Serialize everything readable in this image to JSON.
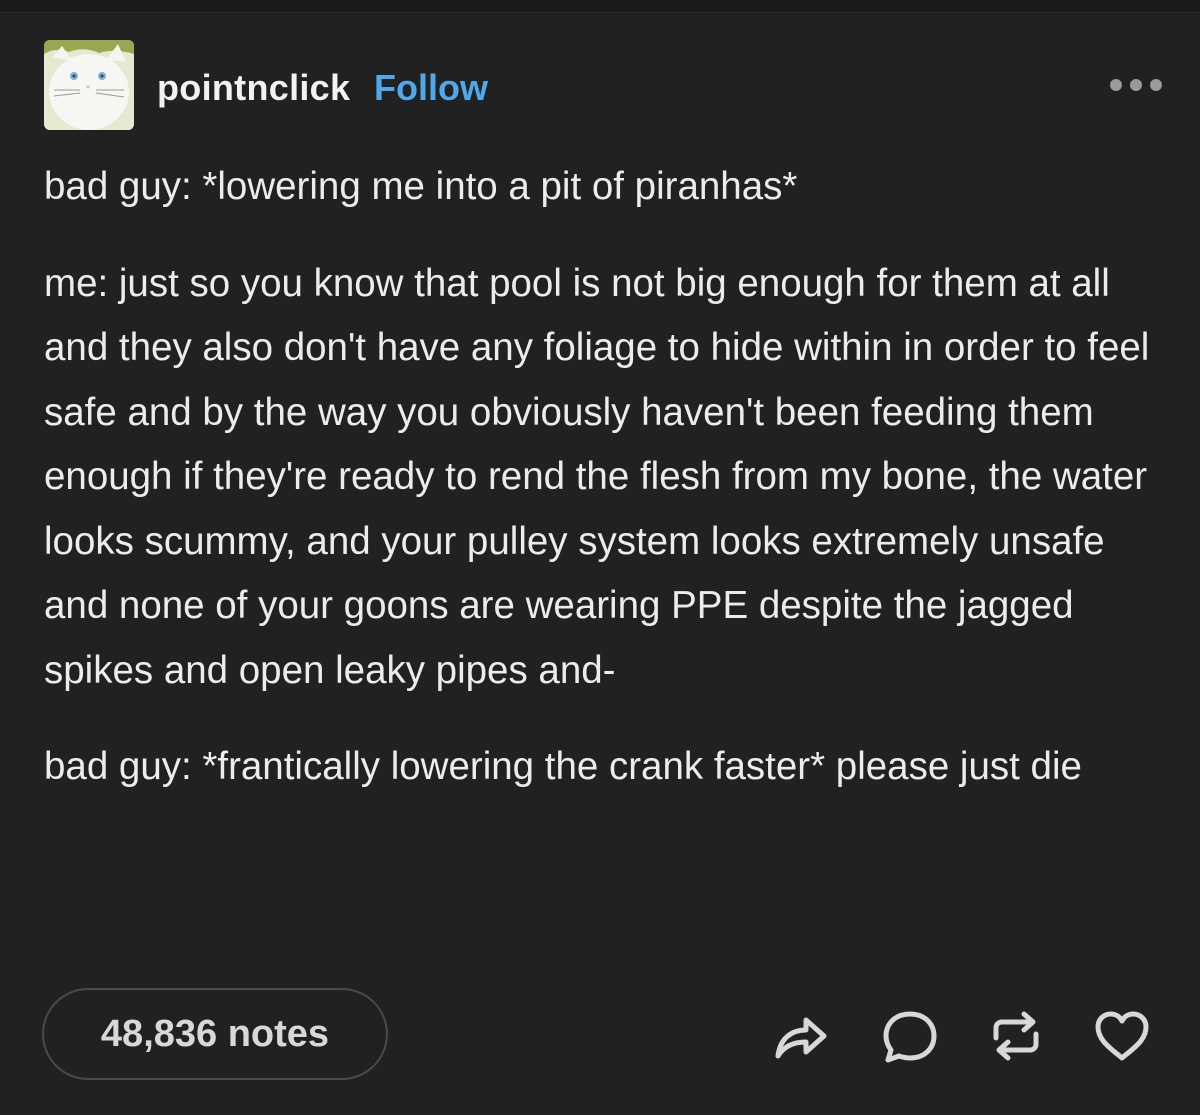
{
  "post": {
    "author": "pointnclick",
    "follow_label": "Follow",
    "paragraphs": [
      "bad guy: *lowering me into a pit of piranhas*",
      "me: just so you know that pool is not big enough for them at all and they also don't have any foliage to hide within in order to feel safe and by the way you obviously haven't been feeding them enough if they're ready to rend the flesh from my bone, the water looks scummy, and your pulley system looks extremely unsafe and none of your goons are wearing PPE despite the jagged spikes and open leaky pipes and-",
      "bad guy: *frantically lowering the crank faster* please just die"
    ],
    "notes_label": "48,836 notes",
    "icons": {
      "avatar": "white-cat-avatar",
      "more": "more-dots-icon",
      "share": "share-icon",
      "reply": "reply-bubble-icon",
      "reblog": "reblog-icon",
      "like": "heart-icon"
    }
  },
  "colors": {
    "background": "#212121",
    "text": "#ececec",
    "follow": "#4fa8ea",
    "notes_border": "#4a4a4a"
  }
}
